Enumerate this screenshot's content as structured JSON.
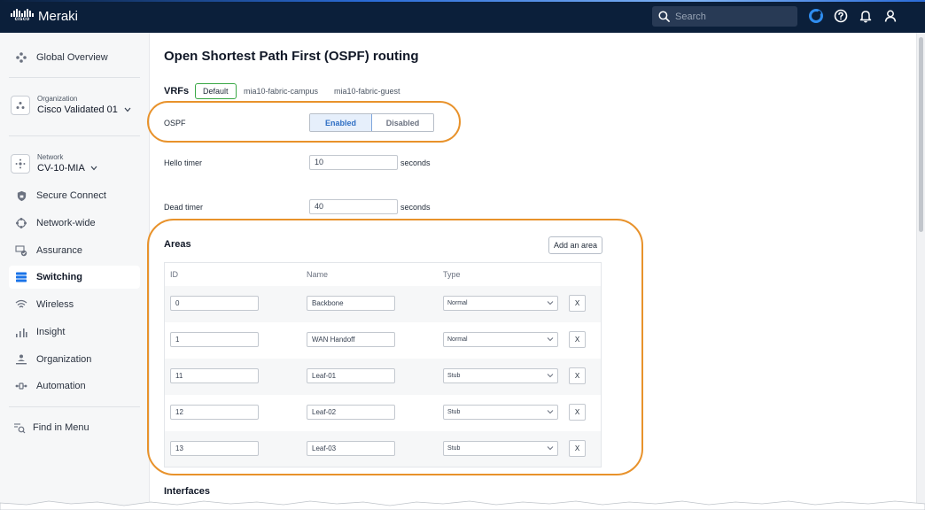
{
  "header": {
    "logo_word": "cisco",
    "app_name": "Meraki",
    "search_placeholder": "Search",
    "icons": [
      "search-icon",
      "product-switcher-icon",
      "help-icon",
      "notifications-icon",
      "user-icon"
    ]
  },
  "sidebar": {
    "global_overview": "Global Overview",
    "organization": {
      "caption": "Organization",
      "value": "Cisco Validated 01"
    },
    "network": {
      "caption": "Network",
      "value": "CV-10-MIA"
    },
    "items": [
      {
        "label": "Secure Connect",
        "icon": "shield-icon"
      },
      {
        "label": "Network-wide",
        "icon": "network-icon"
      },
      {
        "label": "Assurance",
        "icon": "assurance-icon"
      },
      {
        "label": "Switching",
        "icon": "switch-icon",
        "active": true
      },
      {
        "label": "Wireless",
        "icon": "wifi-icon"
      },
      {
        "label": "Insight",
        "icon": "bar-chart-icon"
      },
      {
        "label": "Organization",
        "icon": "organization-icon"
      },
      {
        "label": "Automation",
        "icon": "automation-icon"
      }
    ],
    "find_in_menu": "Find in Menu"
  },
  "main": {
    "title": "Open Shortest Path First (OSPF) routing",
    "vrfs_label": "VRFs",
    "vrf_tabs": [
      "Default",
      "mia10-fabric-campus",
      "mia10-fabric-guest"
    ],
    "ospf": {
      "label": "OSPF",
      "enabled_label": "Enabled",
      "disabled_label": "Disabled",
      "selected": "Enabled"
    },
    "hello_timer": {
      "label": "Hello timer",
      "value": "10",
      "unit": "seconds"
    },
    "dead_timer": {
      "label": "Dead timer",
      "value": "40",
      "unit": "seconds"
    },
    "areas": {
      "title": "Areas",
      "add_button": "Add an area",
      "columns": [
        "ID",
        "Name",
        "Type"
      ],
      "rows": [
        {
          "id": "0",
          "name": "Backbone",
          "type": "Normal"
        },
        {
          "id": "1",
          "name": "WAN Handoff",
          "type": "Normal"
        },
        {
          "id": "11",
          "name": "Leaf-01",
          "type": "Stub"
        },
        {
          "id": "12",
          "name": "Leaf-02",
          "type": "Stub"
        },
        {
          "id": "13",
          "name": "Leaf-03",
          "type": "Stub"
        }
      ],
      "remove_label": "X"
    },
    "interfaces_title": "Interfaces"
  },
  "colors": {
    "header_bg": "#0b1f3a",
    "annotation": "#e8922b",
    "accent_blue": "#2f6fc4",
    "selected_border": "#39a845"
  }
}
